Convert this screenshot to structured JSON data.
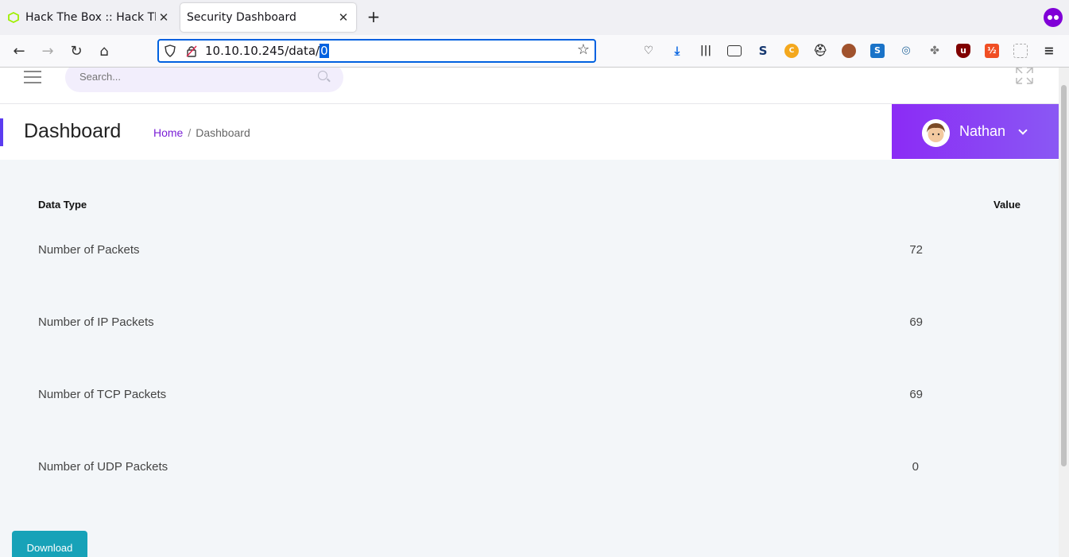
{
  "browser": {
    "tabs": [
      {
        "title": "Hack The Box :: Hack The Box",
        "active": false
      },
      {
        "title": "Security Dashboard",
        "active": true
      }
    ],
    "url": {
      "base": "10.10.10.245/data/",
      "selected": "0"
    }
  },
  "topbar": {
    "search_placeholder": "Search..."
  },
  "header": {
    "title": "Dashboard",
    "breadcrumb": {
      "home": "Home",
      "separator": "/",
      "current": "Dashboard"
    },
    "user": "Nathan"
  },
  "table": {
    "headers": {
      "type": "Data Type",
      "value": "Value"
    },
    "rows": [
      {
        "type": "Number of Packets",
        "value": "72"
      },
      {
        "type": "Number of IP Packets",
        "value": "69"
      },
      {
        "type": "Number of TCP Packets",
        "value": "69"
      },
      {
        "type": "Number of UDP Packets",
        "value": "0"
      }
    ]
  },
  "download_label": "Download",
  "colors": {
    "accent": "#8b2bf5",
    "download": "#17a2b8",
    "url_focus": "#0061e0"
  }
}
